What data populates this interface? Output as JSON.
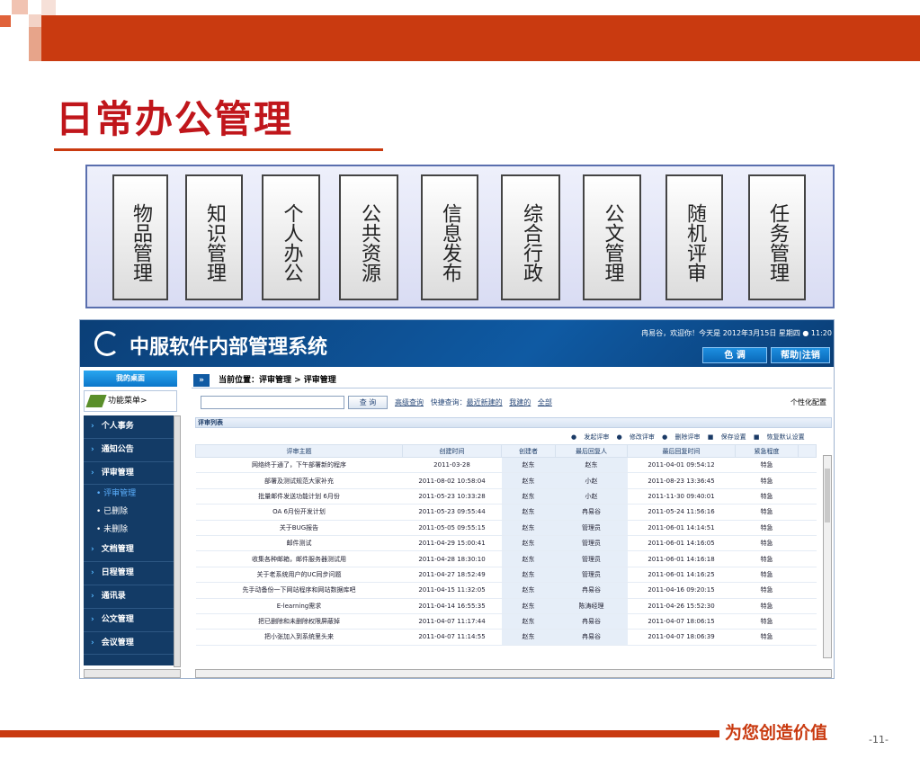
{
  "slide": {
    "title": "日常办公管理",
    "footer_slogan": "为您创造价值",
    "page_number": "-11-",
    "accent_color": "#c93a10"
  },
  "modules": [
    {
      "label": "物品管理"
    },
    {
      "label": "知识管理"
    },
    {
      "label": "个人办公"
    },
    {
      "label": "公共资源"
    },
    {
      "label": "信息发布"
    },
    {
      "label": "综合行政"
    },
    {
      "label": "公文管理"
    },
    {
      "label": "随机评审"
    },
    {
      "label": "任务管理"
    }
  ],
  "app": {
    "title": "中服软件内部管理系统",
    "welcome": "冉易谷，欢迎你！今天是 2012年3月15日 星期四 ● 11:20",
    "btn_color": "色 调",
    "btn_help": "帮助|注销",
    "my_desk": "我的桌面",
    "func_menu": "功能菜单>",
    "menu": [
      {
        "label": "个人事务"
      },
      {
        "label": "通知公告"
      },
      {
        "label": "评审管理"
      }
    ],
    "sub_menu": [
      {
        "label": "• 评审管理",
        "active": true
      },
      {
        "label": "• 已删除",
        "active": false
      },
      {
        "label": "• 未删除",
        "active": false
      }
    ],
    "menu2": [
      {
        "label": "文档管理"
      },
      {
        "label": "日程管理"
      },
      {
        "label": "通讯录"
      },
      {
        "label": "公文管理"
      },
      {
        "label": "会议管理"
      }
    ],
    "breadcrumb": "当前位置：评审管理 > 评审管理",
    "search_btn": "查 询",
    "advanced": "高级查询",
    "quick_label": "快捷查询：",
    "quick_recent": "最近新建的",
    "quick_mine": "我建的",
    "quick_all": "全部",
    "personal": "个性化配置",
    "list_title": "评审列表",
    "actions": {
      "start": "发起评审",
      "edit": "修改评审",
      "delete": "删除评审",
      "save": "保存设置",
      "restore": "恢复默认设置"
    },
    "columns": [
      "评审主题",
      "创建时间",
      "创建者",
      "最后回复人",
      "最后回复时间",
      "紧急程度"
    ],
    "rows": [
      [
        "网络终于通了，下午部署新的程序",
        "2011-03-28",
        "赵东",
        "赵东",
        "2011-04-01 09:54:12",
        "特急"
      ],
      [
        "部署及测试规范大家补充",
        "2011-08-02 10:58:04",
        "赵东",
        "小赵",
        "2011-08-23 13:36:45",
        "特急"
      ],
      [
        "批量邮件发送功能计划 6月份",
        "2011-05-23 10:33:28",
        "赵东",
        "小赵",
        "2011-11-30 09:40:01",
        "特急"
      ],
      [
        "OA 6月份开发计划",
        "2011-05-23 09:55:44",
        "赵东",
        "冉易谷",
        "2011-05-24 11:56:16",
        "特急"
      ],
      [
        "关于BUG报告",
        "2011-05-05 09:55:15",
        "赵东",
        "管理员",
        "2011-06-01 14:14:51",
        "特急"
      ],
      [
        "邮件测试",
        "2011-04-29 15:00:41",
        "赵东",
        "管理员",
        "2011-06-01 14:16:05",
        "特急"
      ],
      [
        "收集各种邮箱，邮件服务器测试用",
        "2011-04-28 18:30:10",
        "赵东",
        "管理员",
        "2011-06-01 14:16:18",
        "特急"
      ],
      [
        "关于老系统用户的UC同步问题",
        "2011-04-27 18:52:49",
        "赵东",
        "管理员",
        "2011-06-01 14:16:25",
        "特急"
      ],
      [
        "先手动备份一下网站程序和网站数据库吧",
        "2011-04-15 11:32:05",
        "赵东",
        "冉易谷",
        "2011-04-16 09:20:15",
        "特急"
      ],
      [
        "E-learning需求",
        "2011-04-14 16:55:35",
        "赵东",
        "陈涛经理",
        "2011-04-26 15:52:30",
        "特急"
      ],
      [
        "把已删除和未删除权限屏蔽掉",
        "2011-04-07 11:17:44",
        "赵东",
        "冉易谷",
        "2011-04-07 18:06:15",
        "特急"
      ],
      [
        "把小张加入到系统里头来",
        "2011-04-07 11:14:55",
        "赵东",
        "冉易谷",
        "2011-04-07 18:06:39",
        "特急"
      ]
    ]
  }
}
